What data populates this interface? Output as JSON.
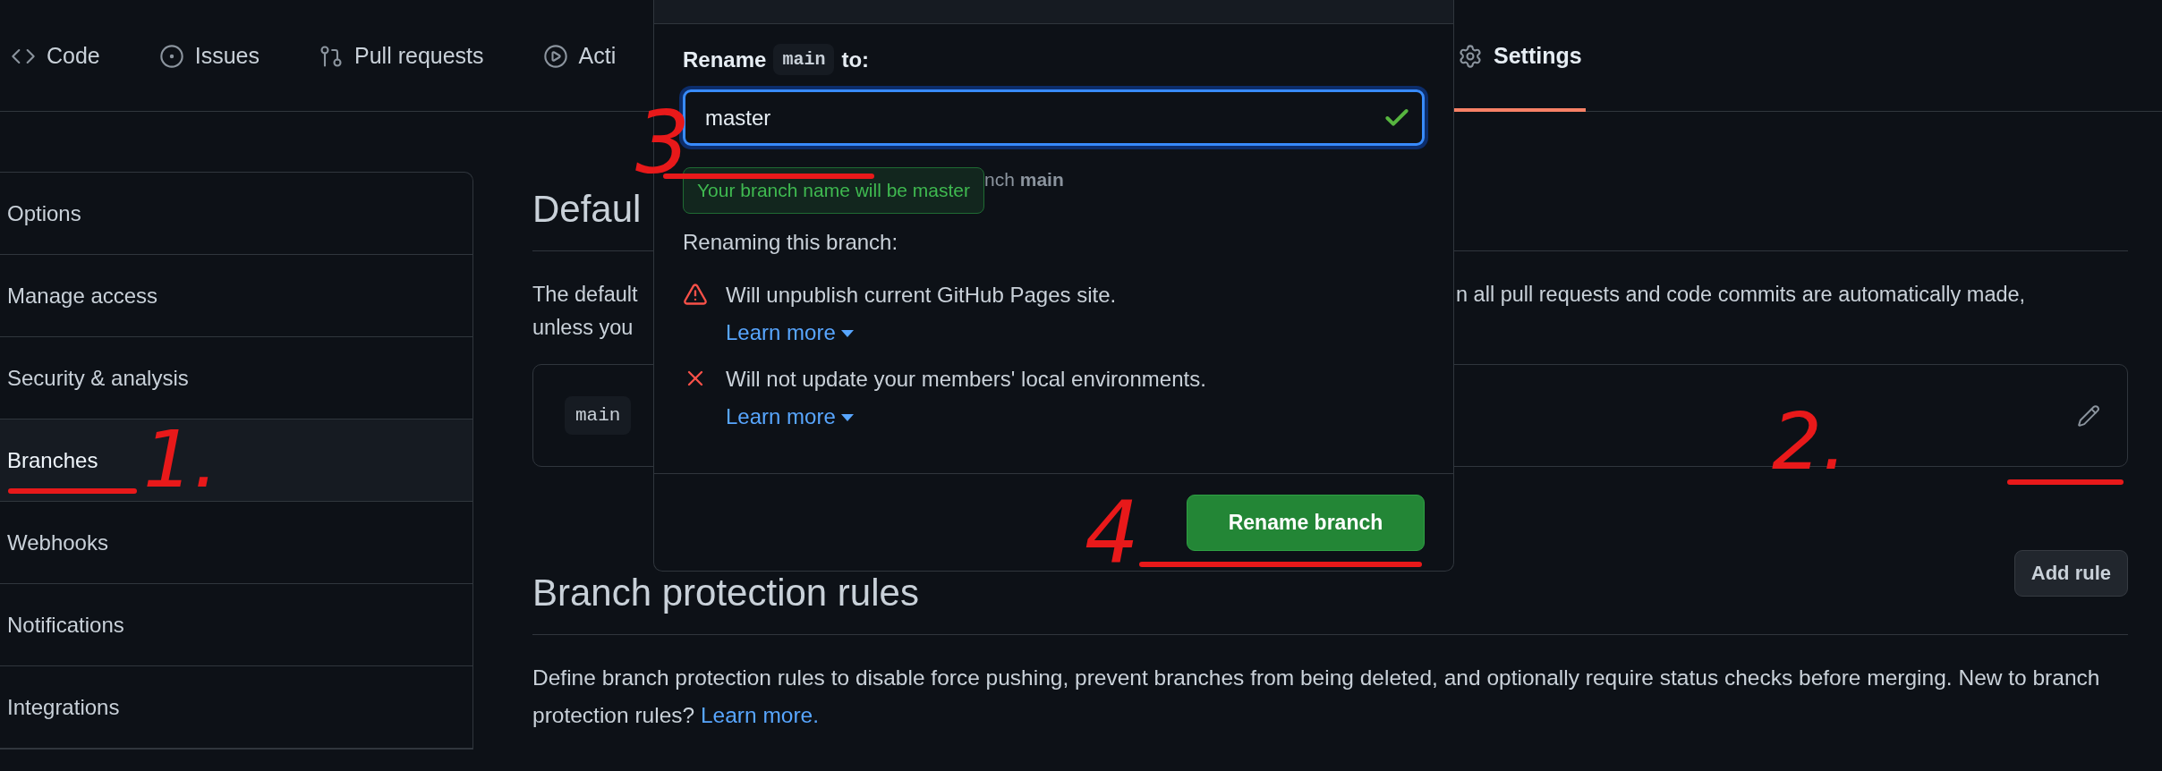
{
  "tabs": [
    {
      "label": "Code",
      "selected": false
    },
    {
      "label": "Issues",
      "selected": false
    },
    {
      "label": "Pull requests",
      "selected": false
    },
    {
      "label": "Acti",
      "selected": false
    },
    {
      "label": "Settings",
      "selected": true
    }
  ],
  "sidebar": {
    "items": [
      {
        "label": "Options",
        "selected": false
      },
      {
        "label": "Manage access",
        "selected": false
      },
      {
        "label": "Security & analysis",
        "selected": false
      },
      {
        "label": "Branches",
        "selected": true
      },
      {
        "label": "Webhooks",
        "selected": false
      },
      {
        "label": "Notifications",
        "selected": false
      },
      {
        "label": "Integrations",
        "selected": false
      }
    ]
  },
  "default_branch": {
    "heading": "Defaul",
    "text_left": [
      "The default",
      "unless you"
    ],
    "text_right": "n all pull requests and code commits are automatically made,",
    "branch": "main"
  },
  "protection": {
    "heading": "Branch protection rules",
    "button": "Add rule",
    "text": "Define branch protection rules to disable force pushing, prevent branches from being deleted, and optionally require status checks before merging. New to branch protection rules?",
    "link": "Learn more."
  },
  "dialog": {
    "label_before": "Rename",
    "label_code": "main",
    "label_after": "to:",
    "value": "master",
    "valid": true,
    "tooltip": "Your branch name will be master",
    "hint": "nch **main**",
    "consequences_title": "Renaming this branch:",
    "consequences": [
      {
        "kind": "warning",
        "text": "Will unpublish current GitHub Pages site.",
        "link": "Learn more"
      },
      {
        "kind": "failure",
        "text": "Will not update your members' local environments.",
        "link": "Learn more"
      }
    ],
    "submit": "Rename branch"
  },
  "annotations": [
    {
      "text": "1."
    },
    {
      "text": "2."
    },
    {
      "text": "3"
    },
    {
      "text": "4"
    }
  ]
}
